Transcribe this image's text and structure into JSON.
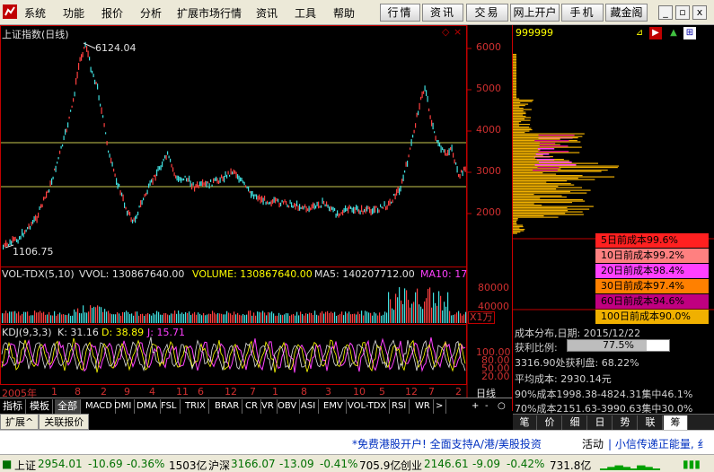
{
  "menu": {
    "items": [
      "系统",
      "功能",
      "报价",
      "分析",
      "扩展市场行情",
      "资讯",
      "工具",
      "帮助"
    ]
  },
  "toolbar": {
    "buttons": [
      "行情",
      "资讯",
      "交易",
      "网上开户",
      "手机",
      "藏金阁"
    ]
  },
  "window_buttons": {
    "minimize": "_",
    "restore": "▫",
    "close": "x"
  },
  "chart": {
    "title": "上证指数(日线)",
    "price_axis": [
      "6000",
      "5000",
      "4000",
      "3000",
      "2000"
    ],
    "high_label": "6124.04",
    "low_label": "1106.75",
    "vol_title": "VOL-TDX(5,10)",
    "vvol": "VVOL: 130867640.00",
    "volume": "VOLUME: 130867640.00",
    "ma5": "MA5: 140207712.00",
    "ma10": "MA10: 17",
    "vol_axis": [
      "80000",
      "40000"
    ],
    "vol_unit": "X1万",
    "kdj_title": "KDJ(9,3,3)",
    "kdj_k": "K: 31.16",
    "kdj_d": "D: 38.89",
    "kdj_j": "J: 15.71",
    "kdj_axis": [
      "100.00",
      "80.00",
      "50.00",
      "20.00"
    ],
    "x_year": "2005年",
    "x_months": [
      "1",
      "8",
      "2",
      "9",
      "4",
      "11",
      "6",
      "12",
      "7",
      "1",
      "8",
      "3",
      "10",
      "5",
      "12",
      "7",
      "2"
    ],
    "period": "日线"
  },
  "chip": {
    "code": "999999",
    "axis": [
      "6000",
      "5000",
      "4000",
      "3000",
      "2000"
    ],
    "legend": [
      {
        "label": "5日前成本99.6%",
        "color": "#ff2020"
      },
      {
        "label": "10日前成本99.2%",
        "color": "#ff8080"
      },
      {
        "label": "20日前成本98.4%",
        "color": "#ff40ff"
      },
      {
        "label": "30日前成本97.4%",
        "color": "#ff8000"
      },
      {
        "label": "60日前成本94.6%",
        "color": "#c00080"
      },
      {
        "label": "100日前成本90.0%",
        "color": "#f0b000"
      }
    ],
    "date_line": "成本分布,日期: 2015/12/22",
    "profit_label": "获利比例:",
    "profit_value": "77.5%",
    "profit_ratio": 0.775,
    "avg_line": "3316.90处获利盘: 68.22%",
    "mean_cost": "平均成本: 2930.14元",
    "c90": "90%成本1998.38-4824.31集中46.1%",
    "c70": "70%成本2151.63-3990.63集中30.0%"
  },
  "tabs": {
    "items": [
      "指标",
      "模板",
      "全部",
      "MACD",
      "DMI",
      "DMA",
      "FSL",
      "TRIX",
      "BRAR",
      "CR",
      "VR",
      "OBV",
      "ASI",
      "EMV",
      "VOL-TDX",
      "RSI",
      "WR"
    ],
    "more": ">",
    "controls": [
      "+",
      "-",
      "○"
    ]
  },
  "right_tabs": [
    "笔",
    "价",
    "细",
    "日",
    "势",
    "联",
    "筹"
  ],
  "sub_tabs": [
    "扩展^",
    "关联报价"
  ],
  "notice": {
    "text1": "*免费港股开户! 全面支持A/港/美股投资",
    "text2": "活动",
    "text3": "| 小信传递正能量, 纟"
  },
  "ticker": {
    "sh_label": "上证",
    "sh_price": "2954.01",
    "sh_change": "-10.69",
    "sh_pct": "-0.36%",
    "sh_amount": "1503亿",
    "hs_label": "沪深",
    "hs_price": "3166.07",
    "hs_change": "-13.09",
    "hs_pct": "-0.41%",
    "hs_amount": "705.9亿",
    "cy_label": "创业",
    "cy_price": "2146.61",
    "cy_change": "-9.09",
    "cy_pct": "-0.42%",
    "cy_amount": "731.8亿"
  }
}
